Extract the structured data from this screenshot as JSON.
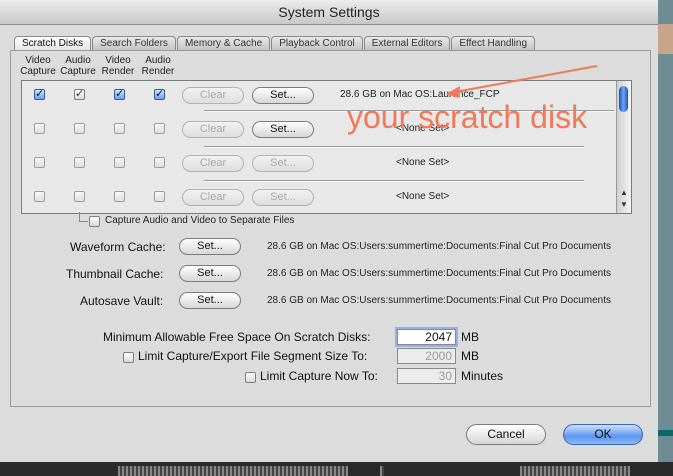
{
  "window": {
    "title": "System Settings"
  },
  "tabs": [
    {
      "label": "Scratch Disks",
      "active": true
    },
    {
      "label": "Search Folders",
      "active": false
    },
    {
      "label": "Memory & Cache",
      "active": false
    },
    {
      "label": "Playback Control",
      "active": false
    },
    {
      "label": "External Editors",
      "active": false
    },
    {
      "label": "Effect Handling",
      "active": false
    }
  ],
  "columns": {
    "video_capture": "Video Capture",
    "audio_capture": "Audio Capture",
    "video_render": "Video Render",
    "audio_render": "Audio Render"
  },
  "scratch_disks": [
    {
      "video_capture": true,
      "audio_capture": true,
      "video_render": true,
      "audio_render": true,
      "clear_label": "Clear",
      "clear_enabled": false,
      "set_label": "Set...",
      "set_enabled": true,
      "info": "28.6 GB on  Mac OS:Laurence_FCP"
    },
    {
      "video_capture": false,
      "audio_capture": false,
      "video_render": false,
      "audio_render": false,
      "clear_label": "Clear",
      "clear_enabled": false,
      "set_label": "Set...",
      "set_enabled": true,
      "info": "<None Set>"
    },
    {
      "video_capture": false,
      "audio_capture": false,
      "video_render": false,
      "audio_render": false,
      "clear_label": "Clear",
      "clear_enabled": false,
      "set_label": "Set...",
      "set_enabled": false,
      "info": "<None Set>"
    },
    {
      "video_capture": false,
      "audio_capture": false,
      "video_render": false,
      "audio_render": false,
      "clear_label": "Clear",
      "clear_enabled": false,
      "set_label": "Set...",
      "set_enabled": false,
      "info": "<None Set>"
    }
  ],
  "separate_files": {
    "label": "Capture Audio and Video to Separate Files",
    "checked": false
  },
  "cache_rows": [
    {
      "label": "Waveform Cache:",
      "button": "Set...",
      "info": "28.6 GB on  Mac OS:Users:summertime:Documents:Final Cut Pro Documents"
    },
    {
      "label": "Thumbnail Cache:",
      "button": "Set...",
      "info": "28.6 GB on  Mac OS:Users:summertime:Documents:Final Cut Pro Documents"
    },
    {
      "label": "Autosave Vault:",
      "button": "Set...",
      "info": "28.6 GB on  Mac OS:Users:summertime:Documents:Final Cut Pro Documents"
    }
  ],
  "min_free_space": {
    "label": "Minimum Allowable Free Space On Scratch Disks:",
    "value": "2047",
    "unit": "MB"
  },
  "segment_size": {
    "label": "Limit Capture/Export File Segment Size To:",
    "value": "2000",
    "unit": "MB",
    "checked": false
  },
  "capture_now": {
    "label": "Limit Capture Now To:",
    "value": "30",
    "unit": "Minutes",
    "checked": false
  },
  "buttons": {
    "cancel": "Cancel",
    "ok": "OK"
  },
  "annotation": {
    "text": "your scratch disk",
    "color": "#f07a57"
  },
  "colors": {
    "accent_blue": "#5b96ee",
    "annotation_red": "#f07a57"
  }
}
